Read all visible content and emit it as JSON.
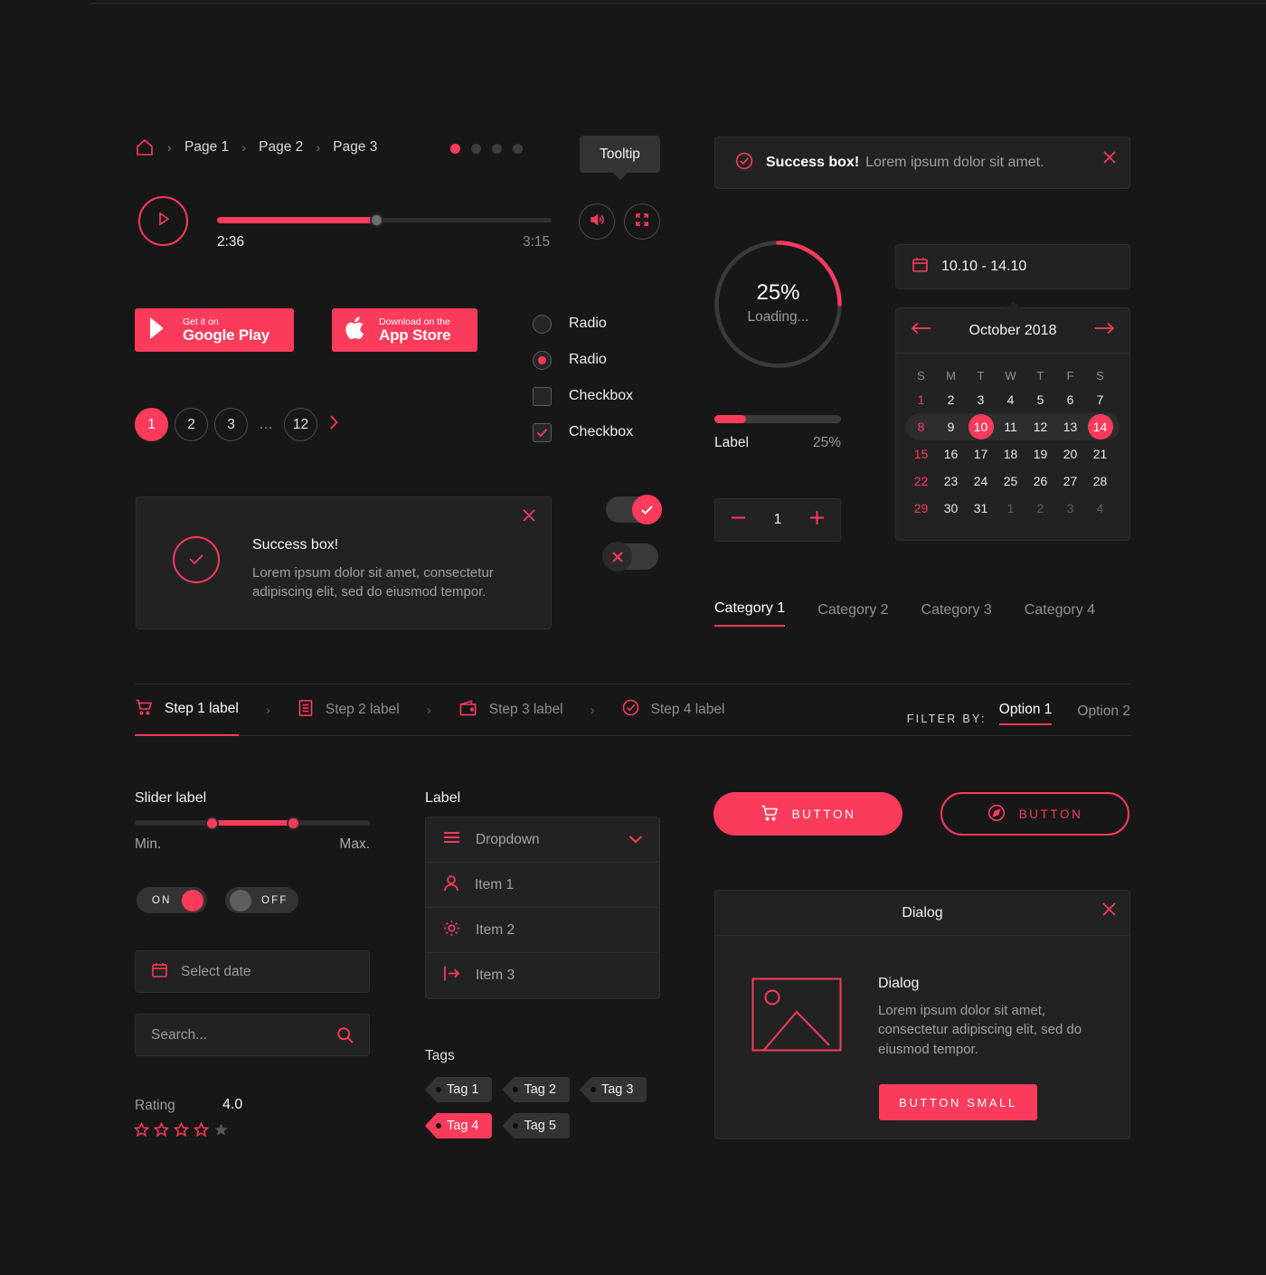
{
  "theme": {
    "accent": "#fb3b5c",
    "page_bg": "#171717",
    "card_bg": "#222222",
    "border": "#2e2e2e",
    "muted_text": "#9a9a9a"
  },
  "breadcrumb": {
    "home_icon": "home-icon",
    "separator": "›",
    "items": [
      "Page 1",
      "Page 2",
      "Page 3"
    ]
  },
  "carousel_dots": {
    "count": 4,
    "active_index": 0
  },
  "tooltip": {
    "label": "Tooltip"
  },
  "player": {
    "play_icon": "play-icon",
    "current_time": "2:36",
    "total_time": "3:15",
    "progress_percent": 48,
    "volume_icon": "volume-icon",
    "fullscreen_icon": "fullscreen-icon"
  },
  "store_buttons": [
    {
      "icon": "google-play-icon",
      "small": "Get it on",
      "large": "Google Play"
    },
    {
      "icon": "apple-icon",
      "small": "Download on the",
      "large": "App Store"
    }
  ],
  "options": [
    {
      "type": "radio",
      "label": "Radio",
      "checked": false
    },
    {
      "type": "radio",
      "label": "Radio",
      "checked": true
    },
    {
      "type": "checkbox",
      "label": "Checkbox",
      "checked": false
    },
    {
      "type": "checkbox",
      "label": "Checkbox",
      "checked": true
    }
  ],
  "pagination": {
    "pages": [
      "1",
      "2",
      "3",
      "…",
      "12"
    ],
    "active": "1",
    "next_icon": "chevron-right-icon"
  },
  "success_box_large": {
    "title": "Success box!",
    "body": "Lorem ipsum dolor sit amet, consectetur adipiscing elit, sed do eiusmod tempor.",
    "check_icon": "check-circle-icon",
    "close_icon": "close-icon"
  },
  "switches": [
    {
      "name": "switch-on",
      "state": "on",
      "icon": "check-icon"
    },
    {
      "name": "switch-off",
      "state": "off",
      "icon": "close-icon"
    }
  ],
  "success_banner": {
    "title": "Success box!",
    "body": "Lorem ipsum dolor sit amet.",
    "check_icon": "check-circle-icon",
    "close_icon": "close-icon"
  },
  "circular_progress": {
    "percent_label": "25%",
    "status": "Loading...",
    "percent": 25
  },
  "linear_progress": {
    "label": "Label",
    "value_label": "25%",
    "percent": 25
  },
  "stepper": {
    "minus_icon": "minus-icon",
    "value": "1",
    "plus_icon": "plus-icon"
  },
  "date_range_input": {
    "calendar_icon": "calendar-icon",
    "value": "10.10 - 14.10"
  },
  "calendar": {
    "prev_icon": "arrow-left-icon",
    "next_icon": "arrow-right-icon",
    "title": "October 2018",
    "day_headers": [
      "S",
      "M",
      "T",
      "W",
      "T",
      "F",
      "S"
    ],
    "weeks": [
      [
        {
          "d": "1",
          "sun": true
        },
        {
          "d": "2"
        },
        {
          "d": "3"
        },
        {
          "d": "4"
        },
        {
          "d": "5"
        },
        {
          "d": "6"
        },
        {
          "d": "7"
        }
      ],
      [
        {
          "d": "8",
          "sun": true
        },
        {
          "d": "9"
        },
        {
          "d": "10",
          "sel": true
        },
        {
          "d": "11"
        },
        {
          "d": "12"
        },
        {
          "d": "13"
        },
        {
          "d": "14",
          "sel": true
        }
      ],
      [
        {
          "d": "15",
          "sun": true
        },
        {
          "d": "16"
        },
        {
          "d": "17"
        },
        {
          "d": "18"
        },
        {
          "d": "19"
        },
        {
          "d": "20"
        },
        {
          "d": "21"
        }
      ],
      [
        {
          "d": "22",
          "sun": true
        },
        {
          "d": "23"
        },
        {
          "d": "24"
        },
        {
          "d": "25"
        },
        {
          "d": "26"
        },
        {
          "d": "27"
        },
        {
          "d": "28"
        }
      ],
      [
        {
          "d": "29",
          "sun": true
        },
        {
          "d": "30"
        },
        {
          "d": "31"
        },
        {
          "d": "1",
          "out": true
        },
        {
          "d": "2",
          "out": true
        },
        {
          "d": "3",
          "out": true
        },
        {
          "d": "4",
          "out": true
        }
      ]
    ],
    "range_week_index": 1
  },
  "categories": {
    "items": [
      "Category 1",
      "Category 2",
      "Category 3",
      "Category 4"
    ],
    "active_index": 0
  },
  "steps": {
    "items": [
      {
        "label": "Step 1 label",
        "icon": "shopping-cart-icon",
        "active": true
      },
      {
        "label": "Step 2 label",
        "icon": "list-document-icon",
        "active": false
      },
      {
        "label": "Step 3 label",
        "icon": "wallet-icon",
        "active": false
      },
      {
        "label": "Step 4 label",
        "icon": "check-circle-icon",
        "active": false
      }
    ],
    "separator": "›"
  },
  "filter": {
    "label": "FILTER BY:",
    "options": [
      "Option 1",
      "Option 2"
    ],
    "active_index": 0
  },
  "range_slider": {
    "label": "Slider label",
    "min_label": "Min.",
    "max_label": "Max.",
    "low": 30,
    "high": 65
  },
  "onoff_toggles": [
    {
      "label": "ON",
      "state": "on"
    },
    {
      "label": "OFF",
      "state": "off"
    }
  ],
  "date_picker_input": {
    "calendar_icon": "calendar-icon",
    "placeholder": "Select date",
    "value": ""
  },
  "search_input": {
    "placeholder": "Search...",
    "value": "",
    "search_icon": "search-icon"
  },
  "rating": {
    "label": "Rating",
    "value": "4.0",
    "stars_total": 5,
    "stars_active": 4
  },
  "dropdown": {
    "label": "Label",
    "head": {
      "icon": "menu-icon",
      "text": "Dropdown",
      "chevron": "chevron-down-icon"
    },
    "items": [
      {
        "icon": "user-icon",
        "text": "Item 1"
      },
      {
        "icon": "gear-icon",
        "text": "Item 2"
      },
      {
        "icon": "logout-icon",
        "text": "Item 3"
      }
    ]
  },
  "tags": {
    "label": "Tags",
    "row1": [
      {
        "text": "Tag 1"
      },
      {
        "text": "Tag 2"
      },
      {
        "text": "Tag 3"
      }
    ],
    "row2": [
      {
        "text": "Tag 4",
        "active": true
      },
      {
        "text": "Tag 5"
      }
    ]
  },
  "action_buttons": [
    {
      "label": "BUTTON",
      "icon": "shopping-cart-icon",
      "style": "filled"
    },
    {
      "label": "BUTTON",
      "icon": "compass-icon",
      "style": "outline"
    }
  ],
  "dialog": {
    "header_title": "Dialog",
    "close_icon": "close-icon",
    "image_icon": "image-placeholder-icon",
    "title": "Dialog",
    "text": "Lorem ipsum dolor sit amet, consectetur adipiscing elit, sed do eiusmod tempor.",
    "button_label": "BUTTON SMALL"
  }
}
